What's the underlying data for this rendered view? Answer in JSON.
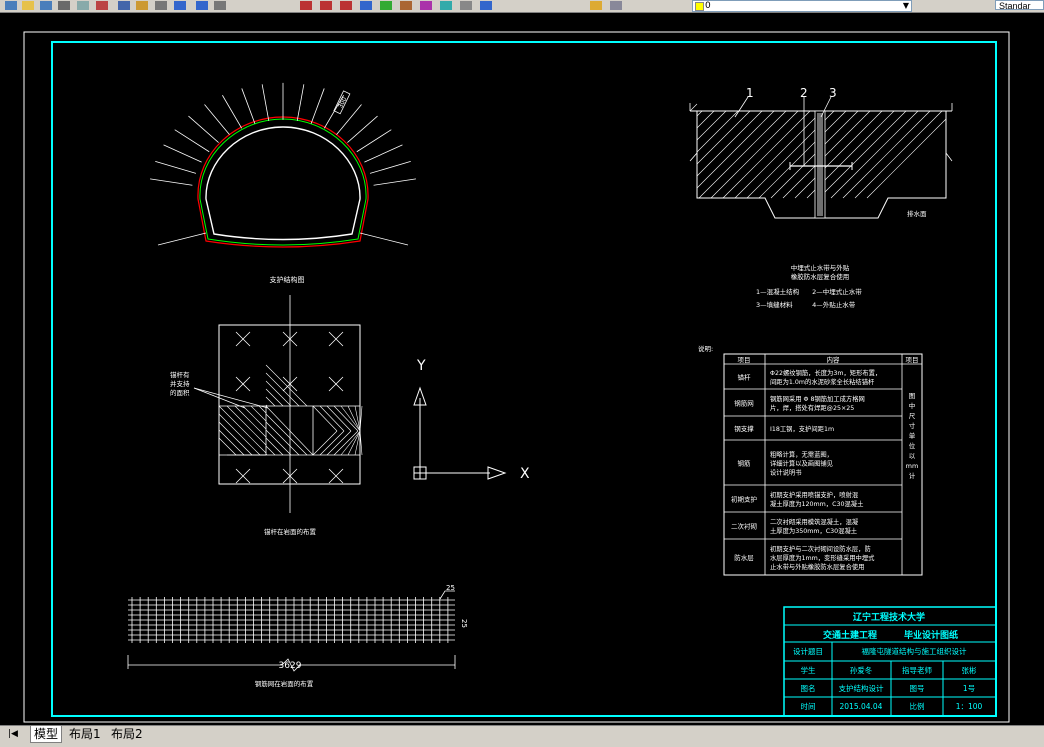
{
  "toolbar": {
    "layer_value": "0",
    "text_style": "Standar",
    "icons": [
      "new-icon",
      "open-icon",
      "save-icon",
      "print-icon",
      "preview-icon",
      "cut-icon",
      "copy-icon",
      "paste-icon",
      "match-prop-icon",
      "undo-icon",
      "redo-icon",
      "pan-icon",
      "zoom-realtime-icon",
      "zoom-window-icon",
      "zoom-prev-icon",
      "properties-icon",
      "design-center-icon",
      "tool-palette-icon",
      "sheet-set-icon",
      "markup-icon",
      "calc-icon",
      "help-icon",
      "layer-manager-icon",
      "layer-state-icon"
    ]
  },
  "tabs": {
    "nav": "|◀",
    "items": [
      "模型",
      "布局1",
      "布局2"
    ]
  },
  "drawing": {
    "tunnel": {
      "bolt_dim": "300",
      "caption": "支护结构图"
    },
    "bolt_plan": {
      "note_lines": [
        "锚杆有",
        "并支持",
        "的面积"
      ],
      "caption": "锚杆在岩面的布置"
    },
    "axes": {
      "x": "X",
      "y": "Y"
    },
    "waterstop": {
      "numbers": [
        "1",
        "2",
        "3"
      ],
      "side_label": "排水面",
      "caption_lines": [
        "中埋式止水带与外贴",
        "橡胶防水层复合使用"
      ],
      "legend_lines": [
        "1—混凝土结构　　2—中埋式止水带",
        "3—填缝材料　　　4—外贴止水带"
      ]
    },
    "mesh": {
      "caption": "钢筋网在岩面的布置",
      "dim_top": "25",
      "dim_side": "25",
      "dim_length": "3629"
    },
    "notes": {
      "label": "说明:",
      "headers": [
        "项目",
        "内容",
        "项目"
      ],
      "rows": [
        {
          "item": "锚杆",
          "lines": [
            "Φ22螺纹钢筋，长度为3m，矩形布置，",
            "间距为1.0m的水泥砂浆全长粘结锚杆"
          ]
        },
        {
          "item": "钢筋网",
          "lines": [
            "钢筋网采用 Φ 8钢筋加工成方格网",
            "片，焊，搭处有焊距@25×25"
          ]
        },
        {
          "item": "钢支撑",
          "lines": [
            "I18工钢，支护间距1m"
          ]
        },
        {
          "item": "钢筋",
          "lines": [
            "粗略计算，无需蓝图，",
            "详细计算以及画图铺见",
            "设计说明书"
          ]
        },
        {
          "item": "初期支护",
          "lines": [
            "初期支护采用喷锚支护，喷射混",
            "凝土厚度为120mm，C30混凝土"
          ]
        },
        {
          "item": "二次衬砌",
          "lines": [
            "二次衬砌采用模筑混凝土，混凝",
            "土厚度为350mm，C30混凝土"
          ]
        },
        {
          "item": "防水层",
          "lines": [
            "初期支护与二次衬砌间设防水层，防",
            "水层厚度为1mm，变形缝采用中埋式",
            "止水带与外贴橡胶防水层复合使用"
          ]
        }
      ],
      "side_text": [
        "图",
        "中",
        "尺",
        "寸",
        "单",
        "位",
        "以",
        "mm",
        "计"
      ]
    },
    "title_block": {
      "school": "辽宁工程技术大学",
      "major": "交通土建工程",
      "design_type": "毕业设计图纸",
      "rows": [
        {
          "l1": "设计题目",
          "v1": "福隆屯隧道结构与施工组织设计",
          "l2": "",
          "v2": ""
        },
        {
          "l1": "学生",
          "v1": "孙爱冬",
          "l2": "指导老师",
          "v2": "张彬"
        },
        {
          "l1": "图名",
          "v1": "支护结构设计",
          "l2": "图号",
          "v2": "1号"
        },
        {
          "l1": "时间",
          "v1": "2015.04.04",
          "l2": "比例",
          "v2": "1：100"
        }
      ]
    }
  },
  "colors": {
    "frame": "#00ffff",
    "lines": "#ffffff",
    "lining_red": "#ff0000",
    "lining_green": "#00ff00",
    "waterstop_dot": "#cccccc"
  }
}
